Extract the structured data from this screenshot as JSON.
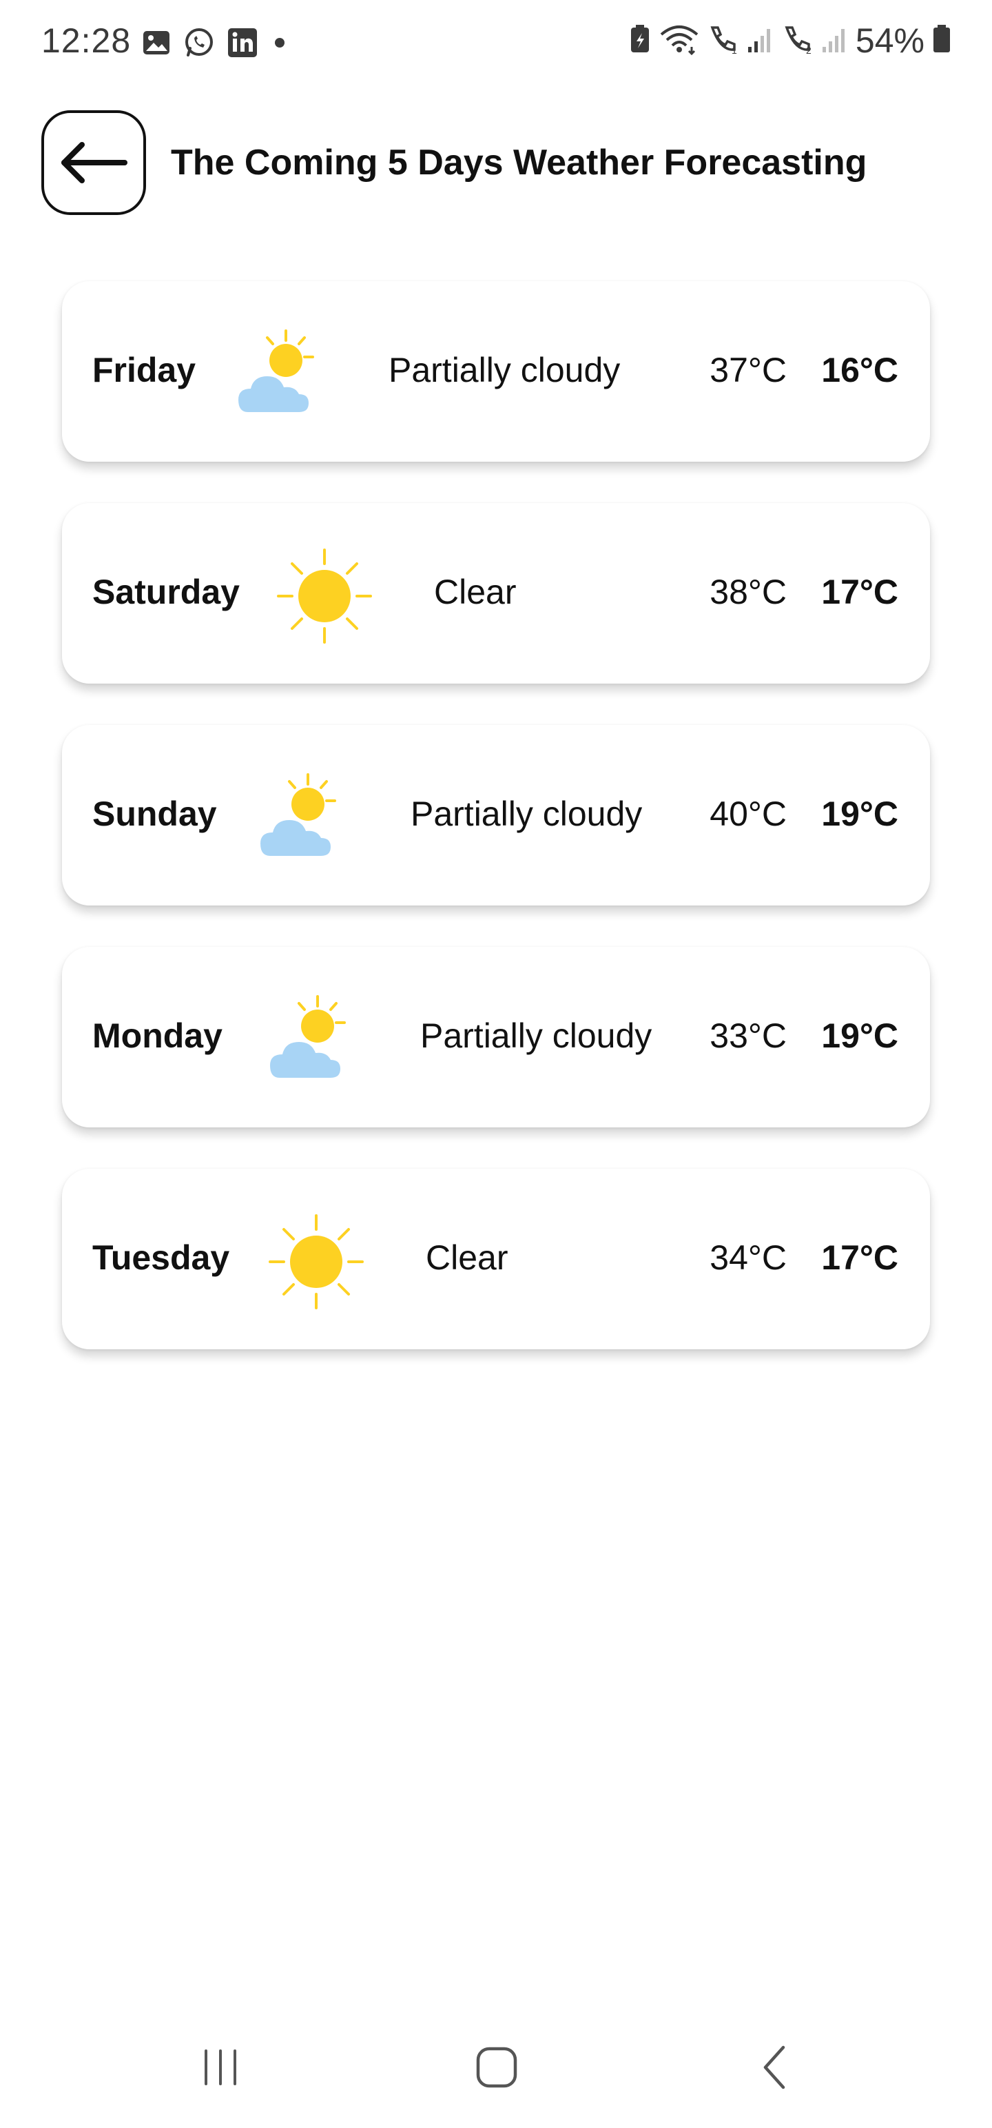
{
  "status_bar": {
    "time": "12:28",
    "battery": "54%",
    "left_icons": [
      "gallery-icon",
      "whatsapp-icon",
      "linkedin-icon",
      "dot-icon"
    ],
    "right_icons": [
      "battery-saver-icon",
      "wifi-icon",
      "call-sim1-icon",
      "signal-icon",
      "call-sim2-icon",
      "signal-icon",
      "battery-icon"
    ]
  },
  "header": {
    "title": "The Coming 5 Days Weather Forecasting",
    "back_icon": "arrow-left-icon"
  },
  "forecast": [
    {
      "day": "Friday",
      "condition": "Partially cloudy",
      "icon": "partly-cloudy-icon",
      "high": "37°C",
      "low": "16°C"
    },
    {
      "day": "Saturday",
      "condition": "Clear",
      "icon": "sun-icon",
      "high": "38°C",
      "low": "17°C"
    },
    {
      "day": "Sunday",
      "condition": "Partially cloudy",
      "icon": "partly-cloudy-icon",
      "high": "40°C",
      "low": "19°C"
    },
    {
      "day": "Monday",
      "condition": "Partially cloudy",
      "icon": "partly-cloudy-icon",
      "high": "33°C",
      "low": "19°C"
    },
    {
      "day": "Tuesday",
      "condition": "Clear",
      "icon": "sun-icon",
      "high": "34°C",
      "low": "17°C"
    }
  ],
  "nav_bar": {
    "buttons": [
      "recent-apps-icon",
      "home-icon",
      "back-icon"
    ]
  },
  "colors": {
    "sun": "#FDD122",
    "cloud": "#A8D4F5",
    "text": "#111111",
    "background": "#FFFFFF"
  }
}
